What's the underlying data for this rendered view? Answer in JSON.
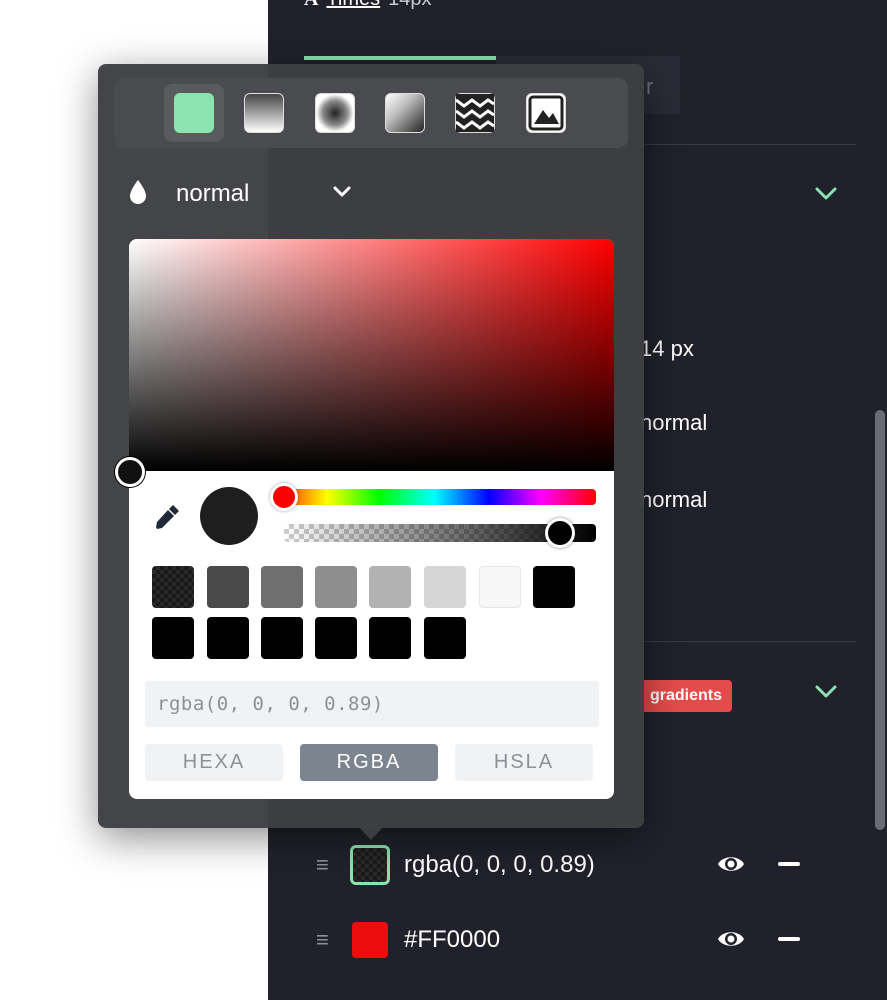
{
  "panel": {
    "font_name": "Times",
    "font_size": "14px",
    "tab_other_label": "r",
    "prop_size": "14  px",
    "prop_weight": "normal",
    "prop_style": "normal",
    "badge": "gradients"
  },
  "layers": [
    {
      "label": "rgba(0, 0, 0, 0.89)",
      "color": "#1b1b1b"
    },
    {
      "label": "#FF0000",
      "color": "#FF0000"
    }
  ],
  "popover": {
    "fill_types": [
      "solid-icon",
      "linear-gradient-icon",
      "radial-gradient-icon",
      "conic-gradient-icon",
      "pattern-icon",
      "image-icon"
    ],
    "active_fill_type": "solid-icon",
    "blend_mode": "normal",
    "hue_color": "#FF0000",
    "alpha_fraction": 0.89,
    "preview_color": "#1E1E1E",
    "presets_row1": [
      "#1F1F1F",
      "#4A4A4A",
      "#6F6F6F",
      "#8E8E8E",
      "#B2B2B2",
      "#D6D6D6",
      "#F7F7F7",
      "#000000"
    ],
    "presets_row2": [
      "#000000",
      "#000000",
      "#000000",
      "#000000",
      "#000000",
      "#000000"
    ],
    "color_value": "rgba(0, 0, 0, 0.89)",
    "modes": [
      "HEXA",
      "RGBA",
      "HSLA"
    ],
    "active_mode": "RGBA"
  },
  "colors": {
    "accent": "#8DE3B0",
    "panel_bg": "#20212B",
    "badge_bg": "#E64B4B"
  }
}
